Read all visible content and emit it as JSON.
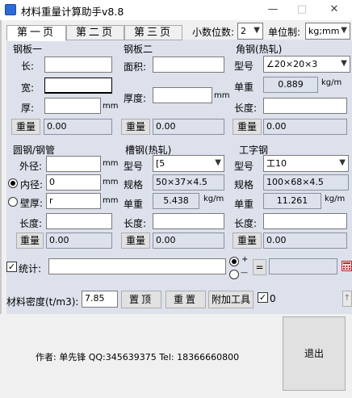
{
  "window": {
    "title": "材料重量计算助手v8.8",
    "minimize": "—",
    "maximize": "□",
    "close": "✕"
  },
  "tabs": [
    {
      "label": "第一页"
    },
    {
      "label": "第二页"
    },
    {
      "label": "第三页"
    }
  ],
  "top_controls": {
    "decimals_label": "小数位数:",
    "decimals_value": "2",
    "unit_label": "单位制:",
    "unit_value": "kg;mm"
  },
  "plate1": {
    "title": "钢板一",
    "length_label": "长:",
    "length_value": "",
    "width_label": "宽:",
    "width_value": "",
    "thickness_label": "厚:",
    "thickness_value": "",
    "thickness_unit": "mm",
    "calc_button": "重量",
    "result": "0.00"
  },
  "plate2": {
    "title": "钢板二",
    "area_label": "面积:",
    "area_value": "",
    "thickness_label": "厚度:",
    "thickness_value": "",
    "thickness_unit": "mm",
    "calc_button": "重量",
    "result": "0.00"
  },
  "angle": {
    "title": "角钢(热轧)",
    "model_label": "型号",
    "model_value": "∠20×20×3",
    "unit_weight_label": "单重",
    "unit_weight_value": "0.889",
    "unit_weight_unit": "kg/m",
    "length_label": "长度:",
    "length_value": "",
    "calc_button": "重量",
    "result": "0.00"
  },
  "round": {
    "title": "圆钢/钢管",
    "outer_label": "外径:",
    "outer_value": "",
    "outer_unit": "mm",
    "inner_label": "内径:",
    "inner_value": "0",
    "inner_unit": "mm",
    "wall_label": "壁厚:",
    "wall_value": "r",
    "wall_unit": "mm",
    "length_label": "长度:",
    "length_value": "",
    "calc_button": "重量",
    "result": "0.00"
  },
  "channel": {
    "title": "槽钢(热轧)",
    "model_label": "型号",
    "model_value": "[5",
    "spec_label": "规格",
    "spec_value": "50×37×4.5",
    "unit_weight_label": "单重",
    "unit_weight_value": "5.438",
    "unit_weight_unit": "kg/m",
    "length_label": "长度:",
    "length_value": "",
    "calc_button": "重量",
    "result": "0.00"
  },
  "ibeam": {
    "title": "工字钢",
    "model_label": "型号",
    "model_value": "工10",
    "spec_label": "规格",
    "spec_value": "100×68×4.5",
    "unit_weight_label": "单重",
    "unit_weight_value": "11.261",
    "unit_weight_unit": "kg/m",
    "length_label": "长度:",
    "length_value": "",
    "calc_button": "重量",
    "result": "0.00"
  },
  "stats": {
    "label": "统计:",
    "value": "",
    "plus": "+",
    "minus": "—",
    "equals": "=",
    "total": ""
  },
  "density": {
    "label": "材料密度(t/m3):",
    "value": "7.85",
    "pin_button": "置顶",
    "reset_button": "重置",
    "tools_button": "附加工具",
    "check_value": "0"
  },
  "footer": {
    "author": "作者: 单先锋 QQ:345639375  Tel: 18366660800",
    "exit_button": "退出"
  }
}
